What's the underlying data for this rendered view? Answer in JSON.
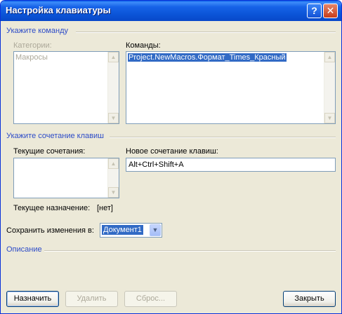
{
  "window": {
    "title": "Настройка клавиатуры"
  },
  "titlebar": {
    "help_glyph": "?",
    "close_glyph": "✕"
  },
  "command_section": {
    "title": "Укажите команду",
    "categories": {
      "label": "Категории:",
      "items": [
        "Макросы"
      ]
    },
    "commands": {
      "label": "Команды:",
      "items": [
        "Project.NewMacros.Формат_Times_Красный"
      ]
    }
  },
  "shortcut_section": {
    "title": "Укажите сочетание клавиш",
    "current_label": "Текущие сочетания:",
    "new_label": "Новое сочетание клавиш:",
    "new_value": "Alt+Ctrl+Shift+A",
    "assignment_label": "Текущее назначение:",
    "assignment_value": "[нет]"
  },
  "save_in": {
    "label": "Сохранить изменения в:",
    "value": "Документ1"
  },
  "description_section": {
    "title": "Описание"
  },
  "buttons": {
    "assign": "Назначить",
    "remove": "Удалить",
    "reset": "Сброс...",
    "close": "Закрыть"
  },
  "icons": {
    "scroll_up": "▲",
    "scroll_down": "▼",
    "combo_arrow": "▼"
  }
}
